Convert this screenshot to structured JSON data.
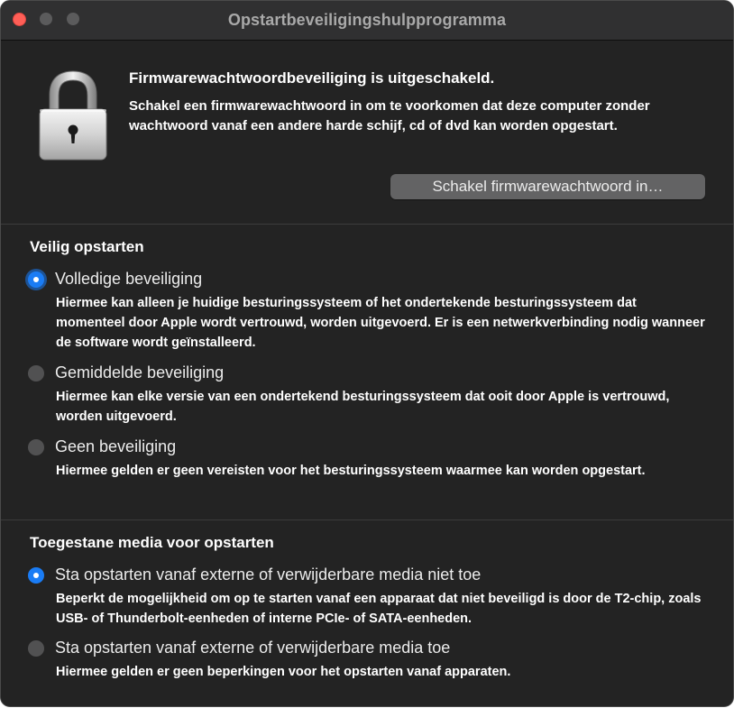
{
  "window": {
    "title": "Opstartbeveiligingshulpprogramma"
  },
  "firmware": {
    "icon": "lock-icon",
    "title": "Firmwarewachtwoordbeveiliging is uitgeschakeld.",
    "description": "Schakel een firmwarewachtwoord in om te voorkomen dat deze computer zonder wachtwoord vanaf een andere harde schijf, cd of dvd kan worden opgestart.",
    "button_label": "Schakel firmwarewachtwoord in…"
  },
  "secure_boot": {
    "title": "Veilig opstarten",
    "options": [
      {
        "label": "Volledige beveiliging",
        "selected": true,
        "description": "Hiermee kan alleen je huidige besturingssysteem of het ondertekende besturingssysteem dat momenteel door Apple wordt vertrouwd, worden uitgevoerd. Er is een netwerkverbinding nodig wanneer de software wordt geïnstalleerd."
      },
      {
        "label": "Gemiddelde beveiliging",
        "selected": false,
        "description": "Hiermee kan elke versie van een ondertekend besturingssysteem dat ooit door Apple is vertrouwd, worden uitgevoerd."
      },
      {
        "label": "Geen beveiliging",
        "selected": false,
        "description": "Hiermee gelden er geen vereisten voor het besturingssysteem waarmee kan worden opgestart."
      }
    ]
  },
  "allowed_media": {
    "title": "Toegestane media voor opstarten",
    "options": [
      {
        "label": "Sta opstarten vanaf externe of verwijderbare media niet toe",
        "selected": true,
        "description": "Beperkt de mogelijkheid om op te starten vanaf een apparaat dat niet beveiligd is door de T2-chip, zoals USB- of Thunderbolt-eenheden of interne PCIe- of SATA-eenheden."
      },
      {
        "label": "Sta opstarten vanaf externe of verwijderbare media toe",
        "selected": false,
        "description": "Hiermee gelden er geen beperkingen voor het opstarten vanaf apparaten."
      }
    ]
  },
  "colors": {
    "accent": "#1a7cf5",
    "window_bg": "#232323",
    "close_button": "#ff5f57"
  }
}
